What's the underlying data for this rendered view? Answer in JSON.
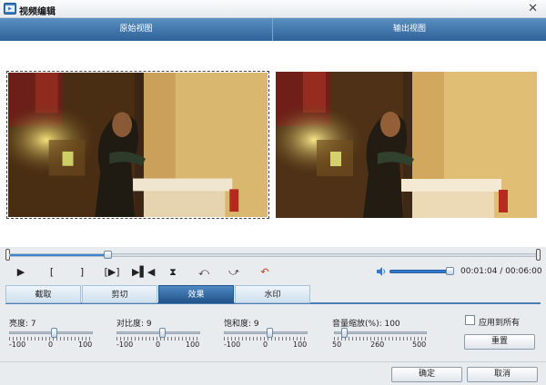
{
  "window": {
    "title": "视频编辑",
    "close_label": "✕"
  },
  "views": {
    "original_label": "原始视图",
    "output_label": "输出视图"
  },
  "timeline": {
    "position_fraction": 0.187
  },
  "controls": {
    "play": "▶",
    "mark_in": "[",
    "mark_out": "]",
    "clip_segment": "[▶]",
    "step": "▶▌◀",
    "flip_vertical": "⧗",
    "rotate_left": "⤺",
    "rotate_right": "⤻",
    "undo": "↶"
  },
  "volume": {
    "level_fraction": 0.95
  },
  "time": {
    "current": "00:01:04",
    "total": "00:06:00",
    "separator": " / "
  },
  "tabs": [
    {
      "label": "截取",
      "active": false
    },
    {
      "label": "剪切",
      "active": false
    },
    {
      "label": "效果",
      "active": true
    },
    {
      "label": "水印",
      "active": false
    }
  ],
  "settings": {
    "brightness": {
      "label": "亮度:",
      "value": "7",
      "min": "-100",
      "mid": "0",
      "max": "100",
      "fraction": 0.535
    },
    "contrast": {
      "label": "对比度:",
      "value": "9",
      "min": "-100",
      "mid": "0",
      "max": "100",
      "fraction": 0.545
    },
    "saturation": {
      "label": "饱和度:",
      "value": "9",
      "min": "-100",
      "mid": "0",
      "max": "100",
      "fraction": 0.545
    },
    "volume_scale": {
      "label": "音量缩放(%):",
      "value": "100",
      "min": "50",
      "mid": "260",
      "max": "500",
      "fraction": 0.11
    },
    "apply_all_label": "应用到所有",
    "apply_all_checked": false,
    "reset_label": "重置"
  },
  "footer": {
    "ok_label": "确定",
    "cancel_label": "取消"
  },
  "colors": {
    "accent": "#2f6299",
    "active_tab": "#23548a",
    "progress": "#3a86d0"
  },
  "icons": {
    "app": "film-app-icon",
    "volume": "speaker-icon"
  }
}
